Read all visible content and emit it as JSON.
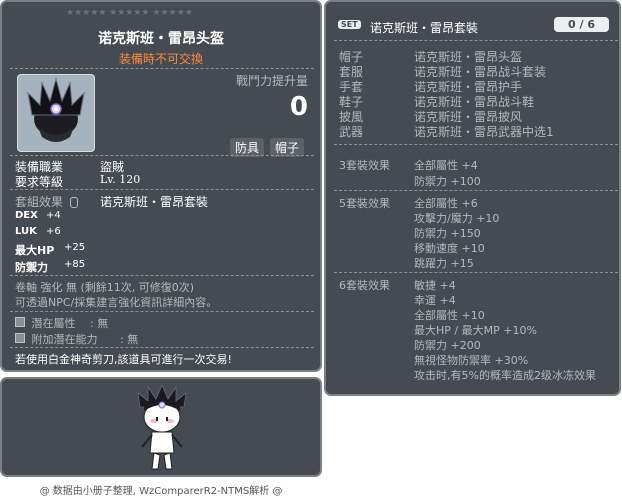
{
  "item_id": "01003157",
  "left": {
    "stars": "★★★★★  ★★★★★  ★★★★★",
    "name": "诺克斯班・雷昂头盔",
    "untradeable": "装備時不可交換",
    "attack_gain_label": "戰鬥力提升量",
    "attack_gain_value": "0",
    "tag1": "防具",
    "tag2": "帽子",
    "job_label": "装備職業",
    "job_value": "盜賊",
    "level_label": "要求等級",
    "level_value": "Lv. 120",
    "set_label": "套組效果",
    "set_value": "诺克斯班・雷昂套裝",
    "stats": [
      {
        "name": "DEX",
        "value": "+4"
      },
      {
        "name": "LUK",
        "value": "+6"
      },
      {
        "name": "最大HP",
        "value": "+25"
      },
      {
        "name": "防禦力",
        "value": "+85"
      }
    ],
    "scroll_line": "卷軸 強化 無 (剩餘11次, 可修復0次)",
    "npc_line": "可透過NPC/採集建言強化資訊詳細內容。",
    "potential_label": "潛在屬性",
    "potential_value": ": 無",
    "add_potential_label": "附加潛在能力",
    "add_potential_value": ": 無",
    "scissors_line": "若使用白金神奇剪刀,該道具可進行一次交易!"
  },
  "right": {
    "set_badge": "SET",
    "set_name": "诺克斯班・雷昂套裝",
    "set_count": "0 / 6",
    "parts": [
      {
        "slot": "帽子",
        "name": "诺克斯班・雷昂头盔"
      },
      {
        "slot": "套服",
        "name": "诺克斯班・雷昂战斗套装"
      },
      {
        "slot": "手套",
        "name": "诺克斯班・雷昂护手"
      },
      {
        "slot": "鞋子",
        "name": "诺克斯班・雷昂战斗鞋"
      },
      {
        "slot": "披風",
        "name": "诺克斯班・雷昂披风"
      },
      {
        "slot": "武器",
        "name": "诺克斯班・雷昂武器中选1"
      }
    ],
    "effects": [
      {
        "title": "3套裝效果",
        "lines": [
          "全部屬性 +4",
          "防禦力 +100"
        ]
      },
      {
        "title": "5套裝效果",
        "lines": [
          "全部屬性 +6",
          "攻擊力/魔力 +10",
          "防禦力 +150",
          "移動速度 +10",
          "跳躍力 +15"
        ]
      },
      {
        "title": "6套裝效果",
        "lines": [
          "敏捷 +4",
          "幸運 +4",
          "全部屬性 +10",
          "最大HP / 最大MP +10%",
          "防禦力 +200",
          "無視怪物防禦率 +30%",
          "攻击时,有5%的概率造成2级冰冻效果"
        ]
      }
    ]
  },
  "footer": "@ 数据由小册子整理, WzComparerR2-NTMS解析 @",
  "colors": {
    "panel": "#454b52",
    "gold": "#ffcc66",
    "orange": "#ff8a3c"
  }
}
